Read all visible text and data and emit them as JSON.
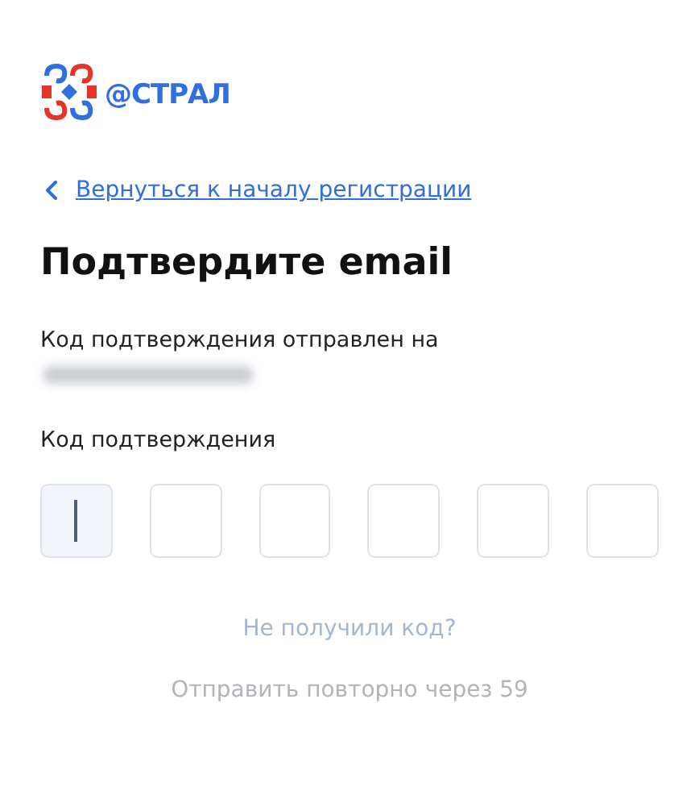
{
  "logo": {
    "wordmark": "@СТРАЛ"
  },
  "back_link": {
    "label": "Вернуться к началу регистрации"
  },
  "title": "Подтвердите email",
  "message": {
    "text": "Код подтверждения отправлен на",
    "email_redacted": true
  },
  "code_field": {
    "label": "Код подтверждения",
    "cells": [
      {
        "focused": true
      },
      {
        "focused": false
      },
      {
        "focused": false
      },
      {
        "focused": false
      },
      {
        "focused": false
      },
      {
        "focused": false
      }
    ]
  },
  "no_code_link": "Не получили код?",
  "resend_note": "Отправить повторно через 59"
}
